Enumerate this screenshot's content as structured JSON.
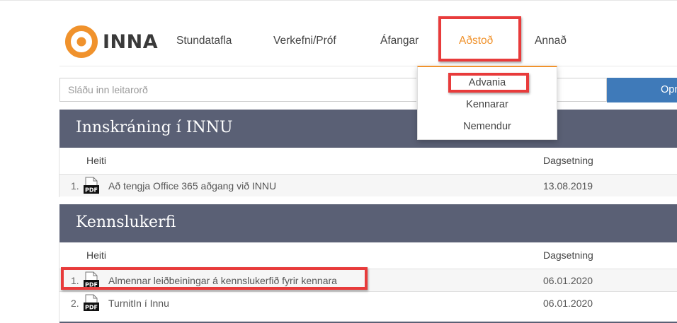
{
  "logo": {
    "text": "INNA",
    "color": "#f0922c"
  },
  "nav": {
    "items": [
      "Stundatafla",
      "Verkefni/Próf",
      "Áfangar",
      "Aðstoð",
      "Annað"
    ],
    "active_index": 3
  },
  "search": {
    "placeholder": "Sláðu inn leitarorð",
    "button_label": "Opna"
  },
  "dropdown": {
    "items": [
      "Advania",
      "Kennarar",
      "Nemendur"
    ]
  },
  "sections": [
    {
      "title": "Innskráning í INNU",
      "columns": [
        "Heiti",
        "Dagsetning"
      ],
      "rows": [
        {
          "num": "1.",
          "icon": "pdf-icon",
          "title": "Að tengja Office 365 aðgang við INNU",
          "date": "13.08.2019"
        }
      ]
    },
    {
      "title": "Kennslukerfi",
      "columns": [
        "Heiti",
        "Dagsetning"
      ],
      "rows": [
        {
          "num": "1.",
          "icon": "pdf-icon",
          "title": "Almennar leiðbeiningar á kennslukerfið fyrir kennara",
          "date": "06.01.2020"
        },
        {
          "num": "2.",
          "icon": "pdf-icon",
          "title": "TurnitIn í Innu",
          "date": "06.01.2020"
        }
      ]
    }
  ],
  "colors": {
    "accent": "#f0922c",
    "section_header": "#5a6075",
    "button": "#3f7ab9",
    "highlight": "#e83b3b"
  }
}
